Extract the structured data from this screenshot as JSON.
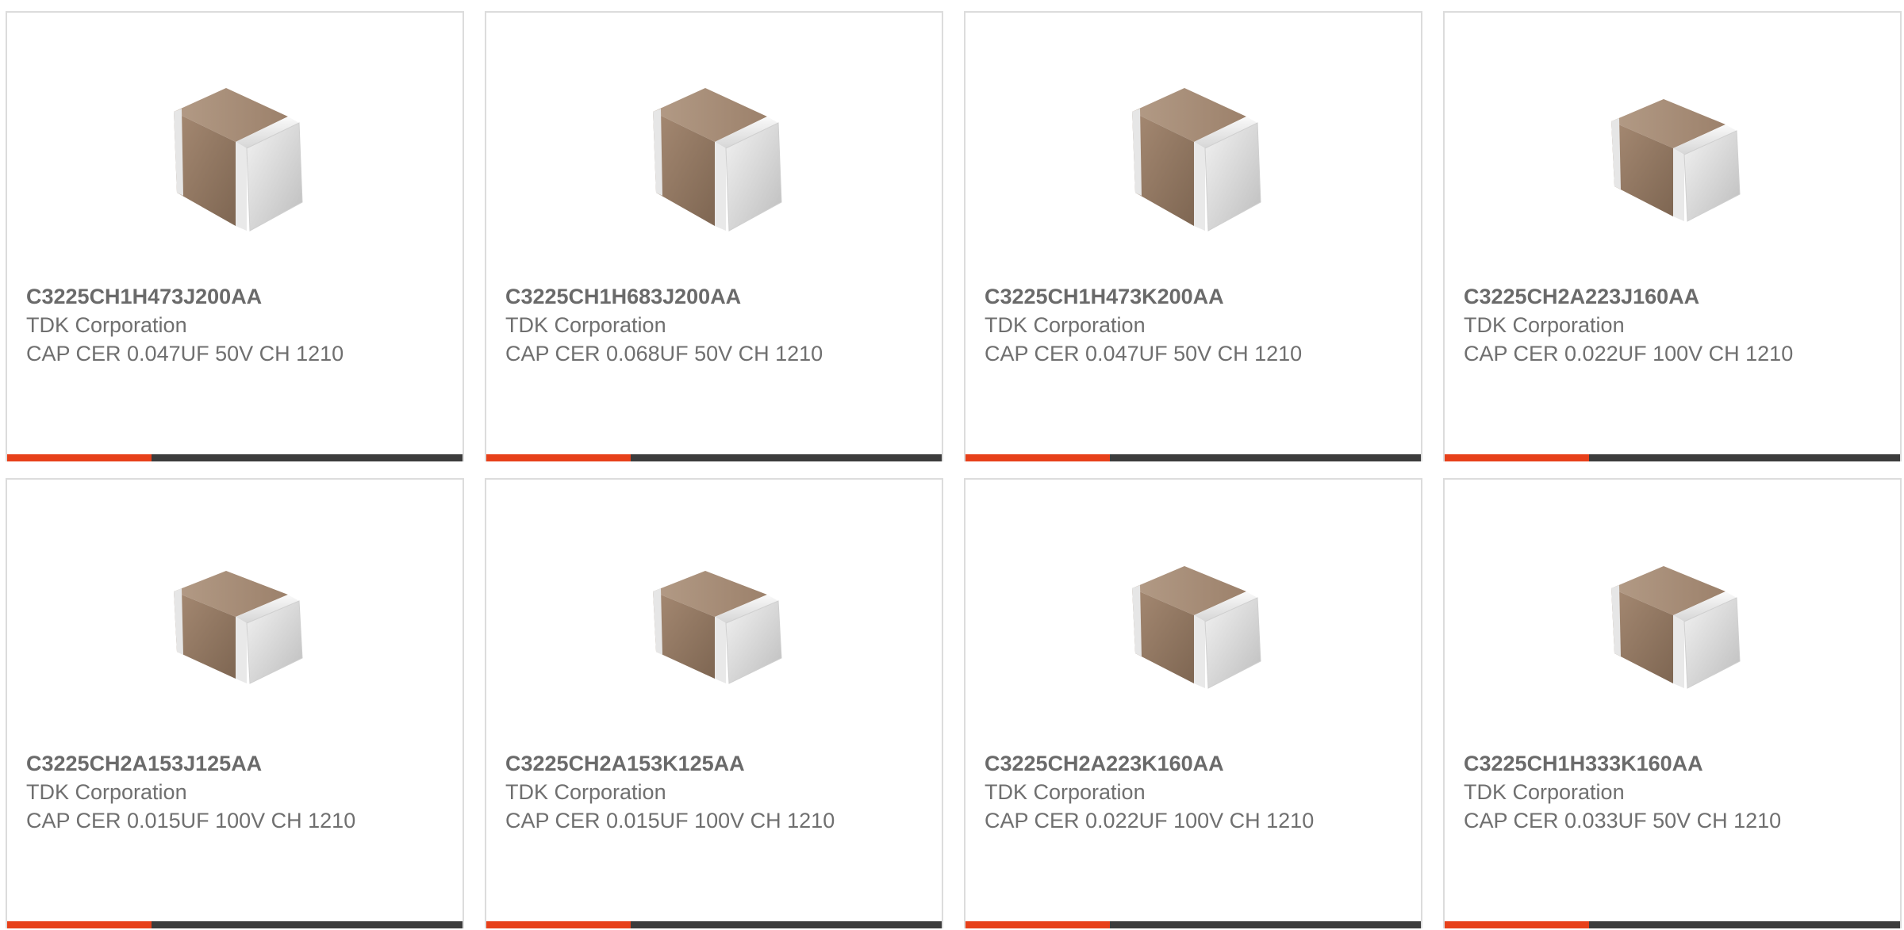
{
  "colors": {
    "accent": "#e7401a",
    "bar": "#3c3c3c",
    "border": "#dcdcdc",
    "text": "#6f6f6f"
  },
  "products": [
    {
      "part_number": "C3225CH1H473J200AA",
      "manufacturer": "TDK Corporation",
      "description": "CAP CER 0.047UF 50V CH 1210",
      "image_icon": "ceramic-capacitor-chip-image"
    },
    {
      "part_number": "C3225CH1H683J200AA",
      "manufacturer": "TDK Corporation",
      "description": "CAP CER 0.068UF 50V CH 1210",
      "image_icon": "ceramic-capacitor-chip-image"
    },
    {
      "part_number": "C3225CH1H473K200AA",
      "manufacturer": "TDK Corporation",
      "description": "CAP CER 0.047UF 50V CH 1210",
      "image_icon": "ceramic-capacitor-chip-image"
    },
    {
      "part_number": "C3225CH2A223J160AA",
      "manufacturer": "TDK Corporation",
      "description": "CAP CER 0.022UF 100V CH 1210",
      "image_icon": "ceramic-capacitor-chip-image"
    },
    {
      "part_number": "C3225CH2A153J125AA",
      "manufacturer": "TDK Corporation",
      "description": "CAP CER 0.015UF 100V CH 1210",
      "image_icon": "ceramic-capacitor-chip-image"
    },
    {
      "part_number": "C3225CH2A153K125AA",
      "manufacturer": "TDK Corporation",
      "description": "CAP CER 0.015UF 100V CH 1210",
      "image_icon": "ceramic-capacitor-chip-image"
    },
    {
      "part_number": "C3225CH2A223K160AA",
      "manufacturer": "TDK Corporation",
      "description": "CAP CER 0.022UF 100V CH 1210",
      "image_icon": "ceramic-capacitor-chip-image"
    },
    {
      "part_number": "C3225CH1H333K160AA",
      "manufacturer": "TDK Corporation",
      "description": "CAP CER 0.033UF 50V CH 1210",
      "image_icon": "ceramic-capacitor-chip-image"
    }
  ]
}
